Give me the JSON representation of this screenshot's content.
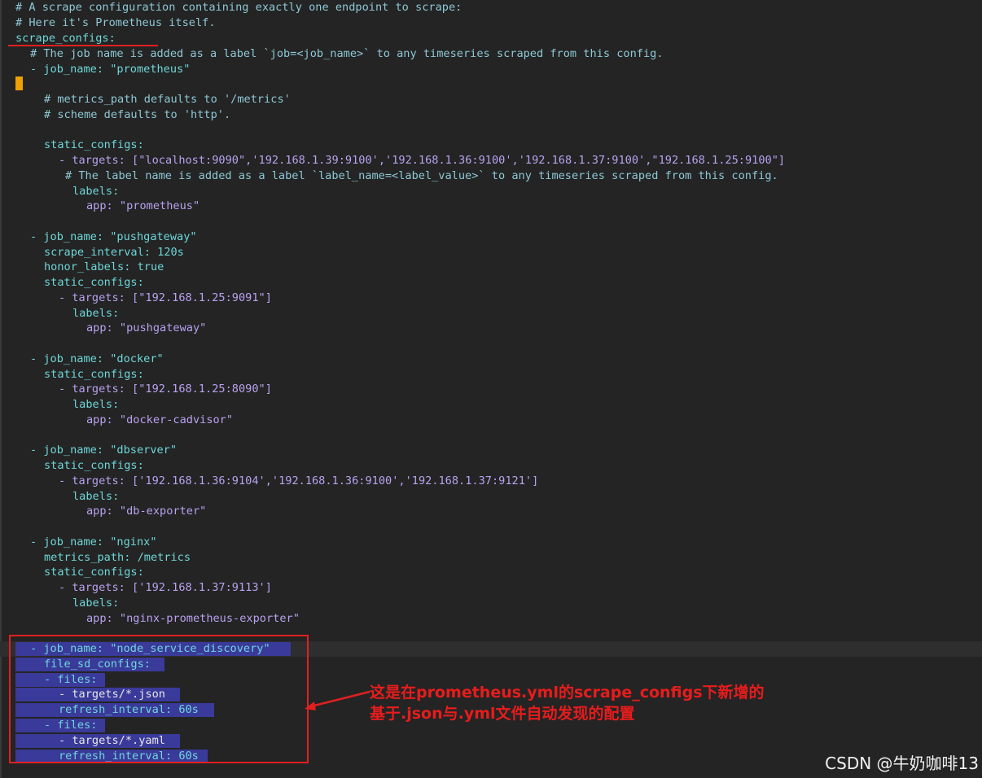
{
  "lines": [
    "# A scrape configuration containing exactly one endpoint to scrape:",
    "# Here it's Prometheus itself.",
    "scrape_configs:",
    "# The job name is added as a label `job=<job_name>` to any timeseries scraped from this config.",
    "- job_name: \"prometheus\"",
    "# metrics_path defaults to '/metrics'",
    "# scheme defaults to 'http'.",
    "static_configs:",
    "- targets: [\"localhost:9090\",'192.168.1.39:9100','192.168.1.36:9100','192.168.1.37:9100',\"192.168.1.25:9100\"]",
    "# The label name is added as a label `label_name=<label_value>` to any timeseries scraped from this config.",
    "labels:",
    "app: \"prometheus\"",
    "- job_name: \"pushgateway\"",
    "scrape_interval: 120s",
    "honor_labels: true",
    "static_configs:",
    "- targets: [\"192.168.1.25:9091\"]",
    "labels:",
    "app: \"pushgateway\"",
    "- job_name: \"docker\"",
    "static_configs:",
    "- targets: [\"192.168.1.25:8090\"]",
    "labels:",
    "app: \"docker-cadvisor\"",
    "- job_name: \"dbserver\"",
    "static_configs:",
    "- targets: ['192.168.1.36:9104','192.168.1.36:9100','192.168.1.37:9121']",
    "labels:",
    "app: \"db-exporter\"",
    "- job_name: \"nginx\"",
    "metrics_path: /metrics",
    "static_configs:",
    "- targets: ['192.168.1.37:9113']",
    "labels:",
    "app: \"nginx-prometheus-exporter\"",
    "- job_name: \"node_service_discovery\"",
    "file_sd_configs:",
    "- files:",
    "- targets/*.json",
    "refresh_interval: 60s",
    "- files:",
    "- targets/*.yaml",
    "refresh_interval: 60s"
  ],
  "annotation": {
    "line1": "这是在prometheus.yml的scrape_configs下新增的",
    "line2": "基于.json与.yml文件自动发现的配置"
  },
  "watermark": "CSDN @牛奶咖啡13",
  "colors": {
    "background": "#242424",
    "highlight_box": "#e02020",
    "selection": "#3a3a9a",
    "cursor": "#f0a000"
  }
}
